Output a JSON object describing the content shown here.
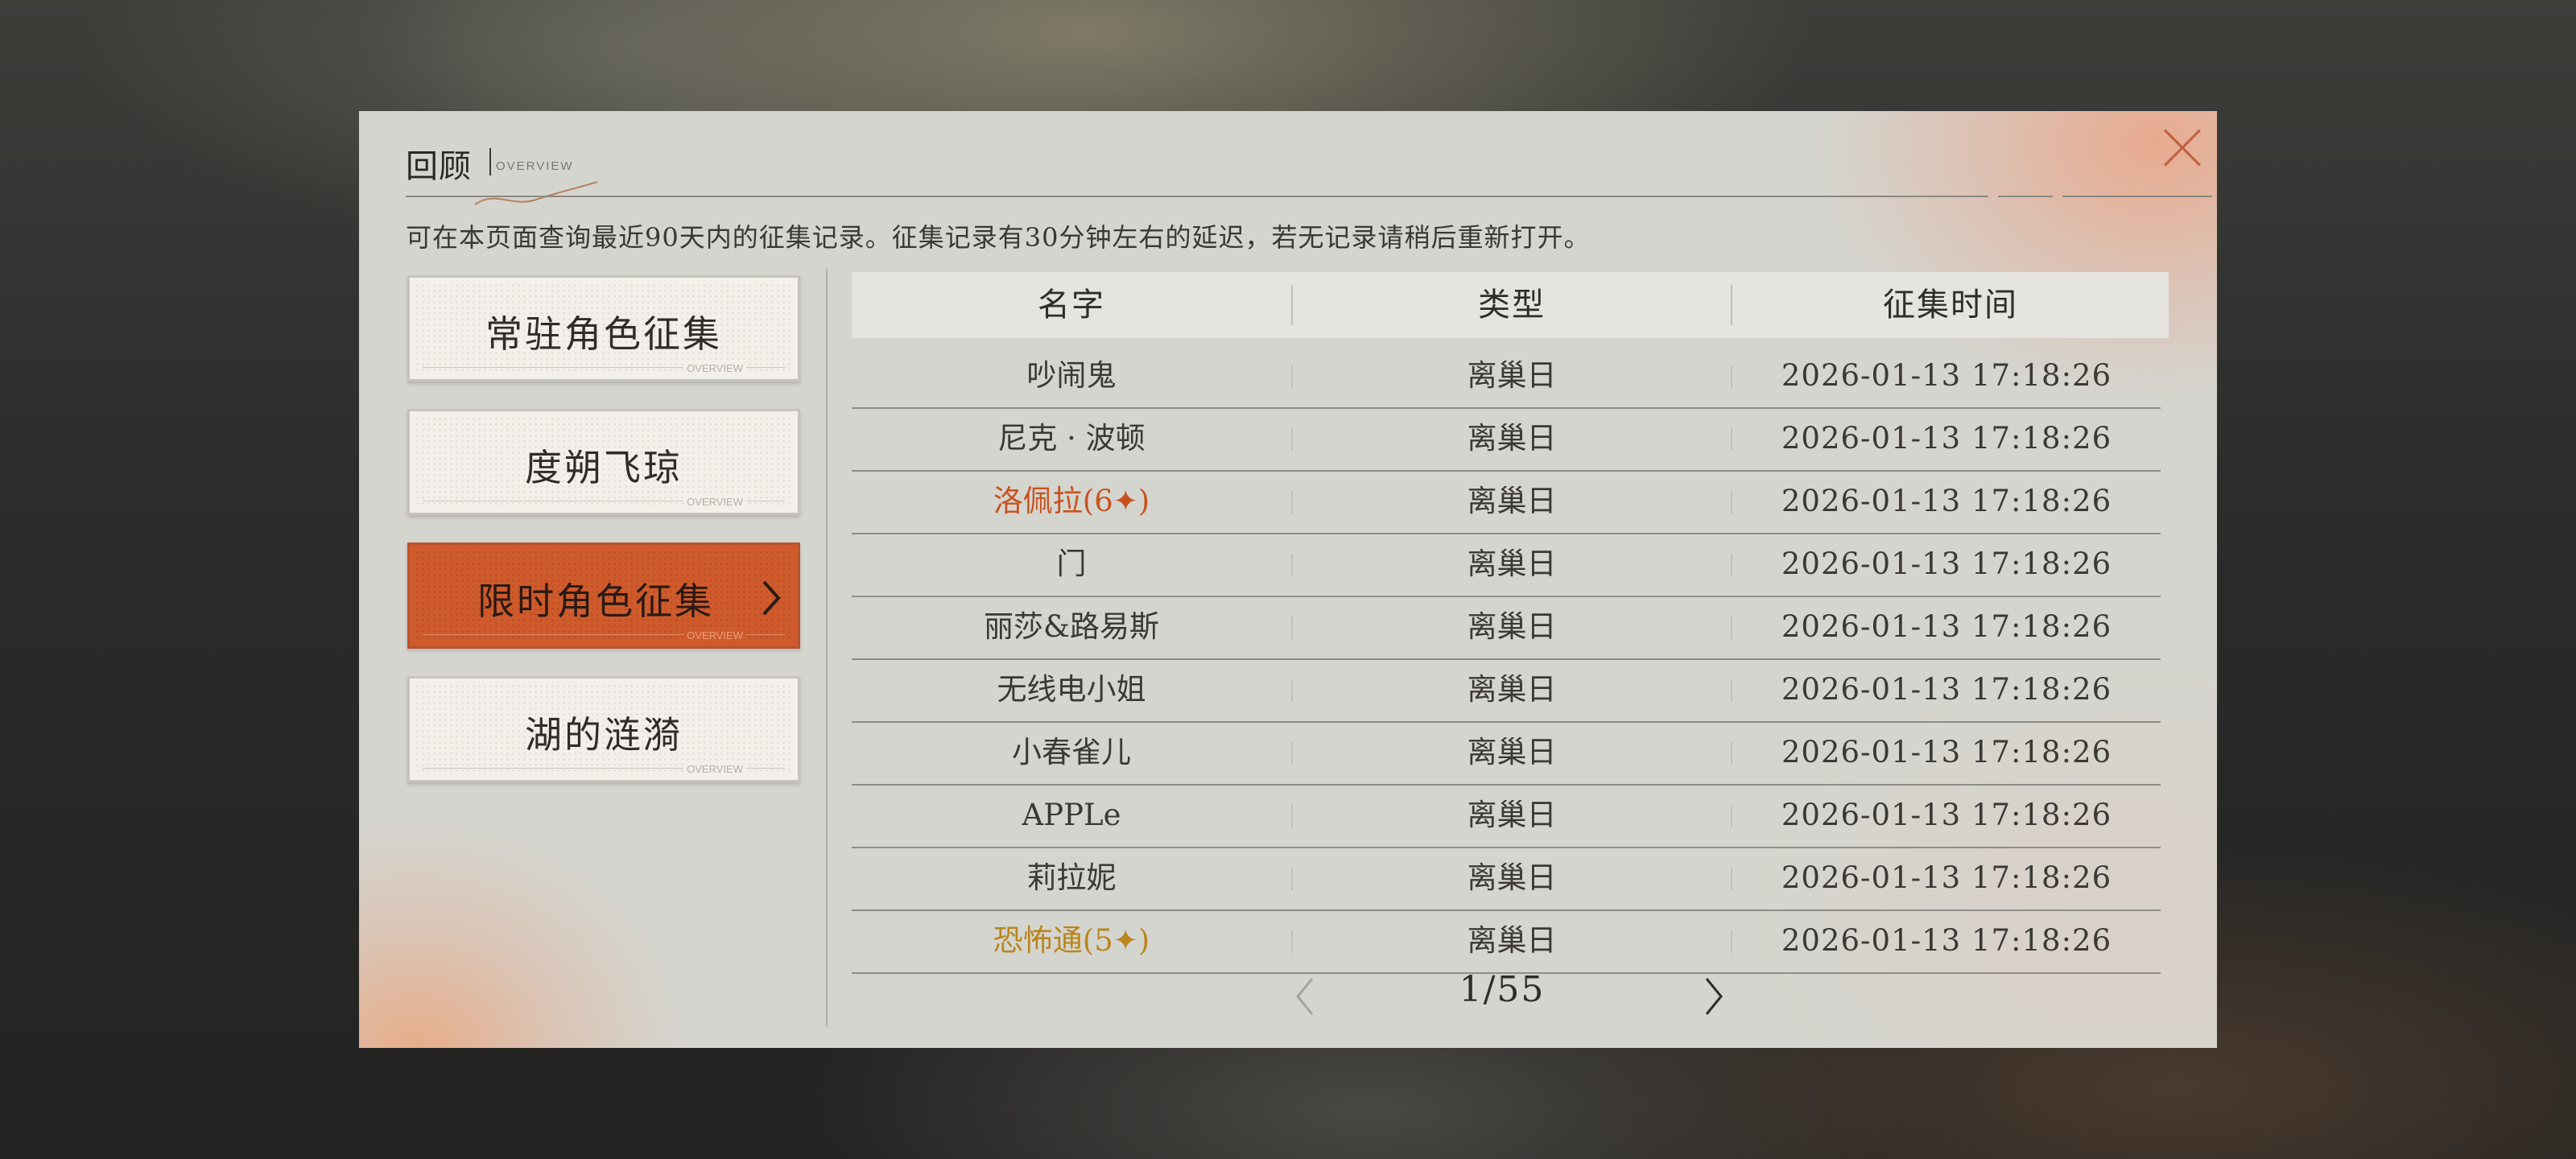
{
  "header": {
    "title": "回顾",
    "subtitle": "OVERVIEW",
    "description": "可在本页面查询最近90天内的征集记录。征集记录有30分钟左右的延迟，若无记录请稍后重新打开。"
  },
  "menu": [
    {
      "label": "常驻角色征集",
      "deco": "OVERVIEW",
      "active": false
    },
    {
      "label": "度朔飞琼",
      "deco": "OVERVIEW",
      "active": false
    },
    {
      "label": "限时角色征集",
      "deco": "OVERVIEW",
      "active": true
    },
    {
      "label": "湖的涟漪",
      "deco": "OVERVIEW",
      "active": false
    }
  ],
  "table": {
    "headers": [
      "名字",
      "类型",
      "征集时间"
    ],
    "rows": [
      {
        "name": "吵闹鬼",
        "type": "离巢日",
        "time": "2026-01-13 17:18:26",
        "rarity": "normal"
      },
      {
        "name": "尼克 · 波顿",
        "type": "离巢日",
        "time": "2026-01-13 17:18:26",
        "rarity": "normal"
      },
      {
        "name": "洛佩拉(6✦)",
        "type": "离巢日",
        "time": "2026-01-13 17:18:26",
        "rarity": "six"
      },
      {
        "name": "门",
        "type": "离巢日",
        "time": "2026-01-13 17:18:26",
        "rarity": "normal"
      },
      {
        "name": "丽莎&路易斯",
        "type": "离巢日",
        "time": "2026-01-13 17:18:26",
        "rarity": "normal"
      },
      {
        "name": "无线电小姐",
        "type": "离巢日",
        "time": "2026-01-13 17:18:26",
        "rarity": "normal"
      },
      {
        "name": "小春雀儿",
        "type": "离巢日",
        "time": "2026-01-13 17:18:26",
        "rarity": "normal"
      },
      {
        "name": "APPLe",
        "type": "离巢日",
        "time": "2026-01-13 17:18:26",
        "rarity": "normal"
      },
      {
        "name": "莉拉妮",
        "type": "离巢日",
        "time": "2026-01-13 17:18:26",
        "rarity": "normal"
      },
      {
        "name": "恐怖通(5✦)",
        "type": "离巢日",
        "time": "2026-01-13 17:18:26",
        "rarity": "five"
      }
    ]
  },
  "pagination": {
    "text": "1/55"
  },
  "colors": {
    "six_star": "#c8521f",
    "five_star": "#b8861d",
    "accent": "#cf5a2c"
  },
  "icons": {
    "close": "close-icon",
    "prev": "chevron-left-icon",
    "next": "chevron-right-icon"
  }
}
